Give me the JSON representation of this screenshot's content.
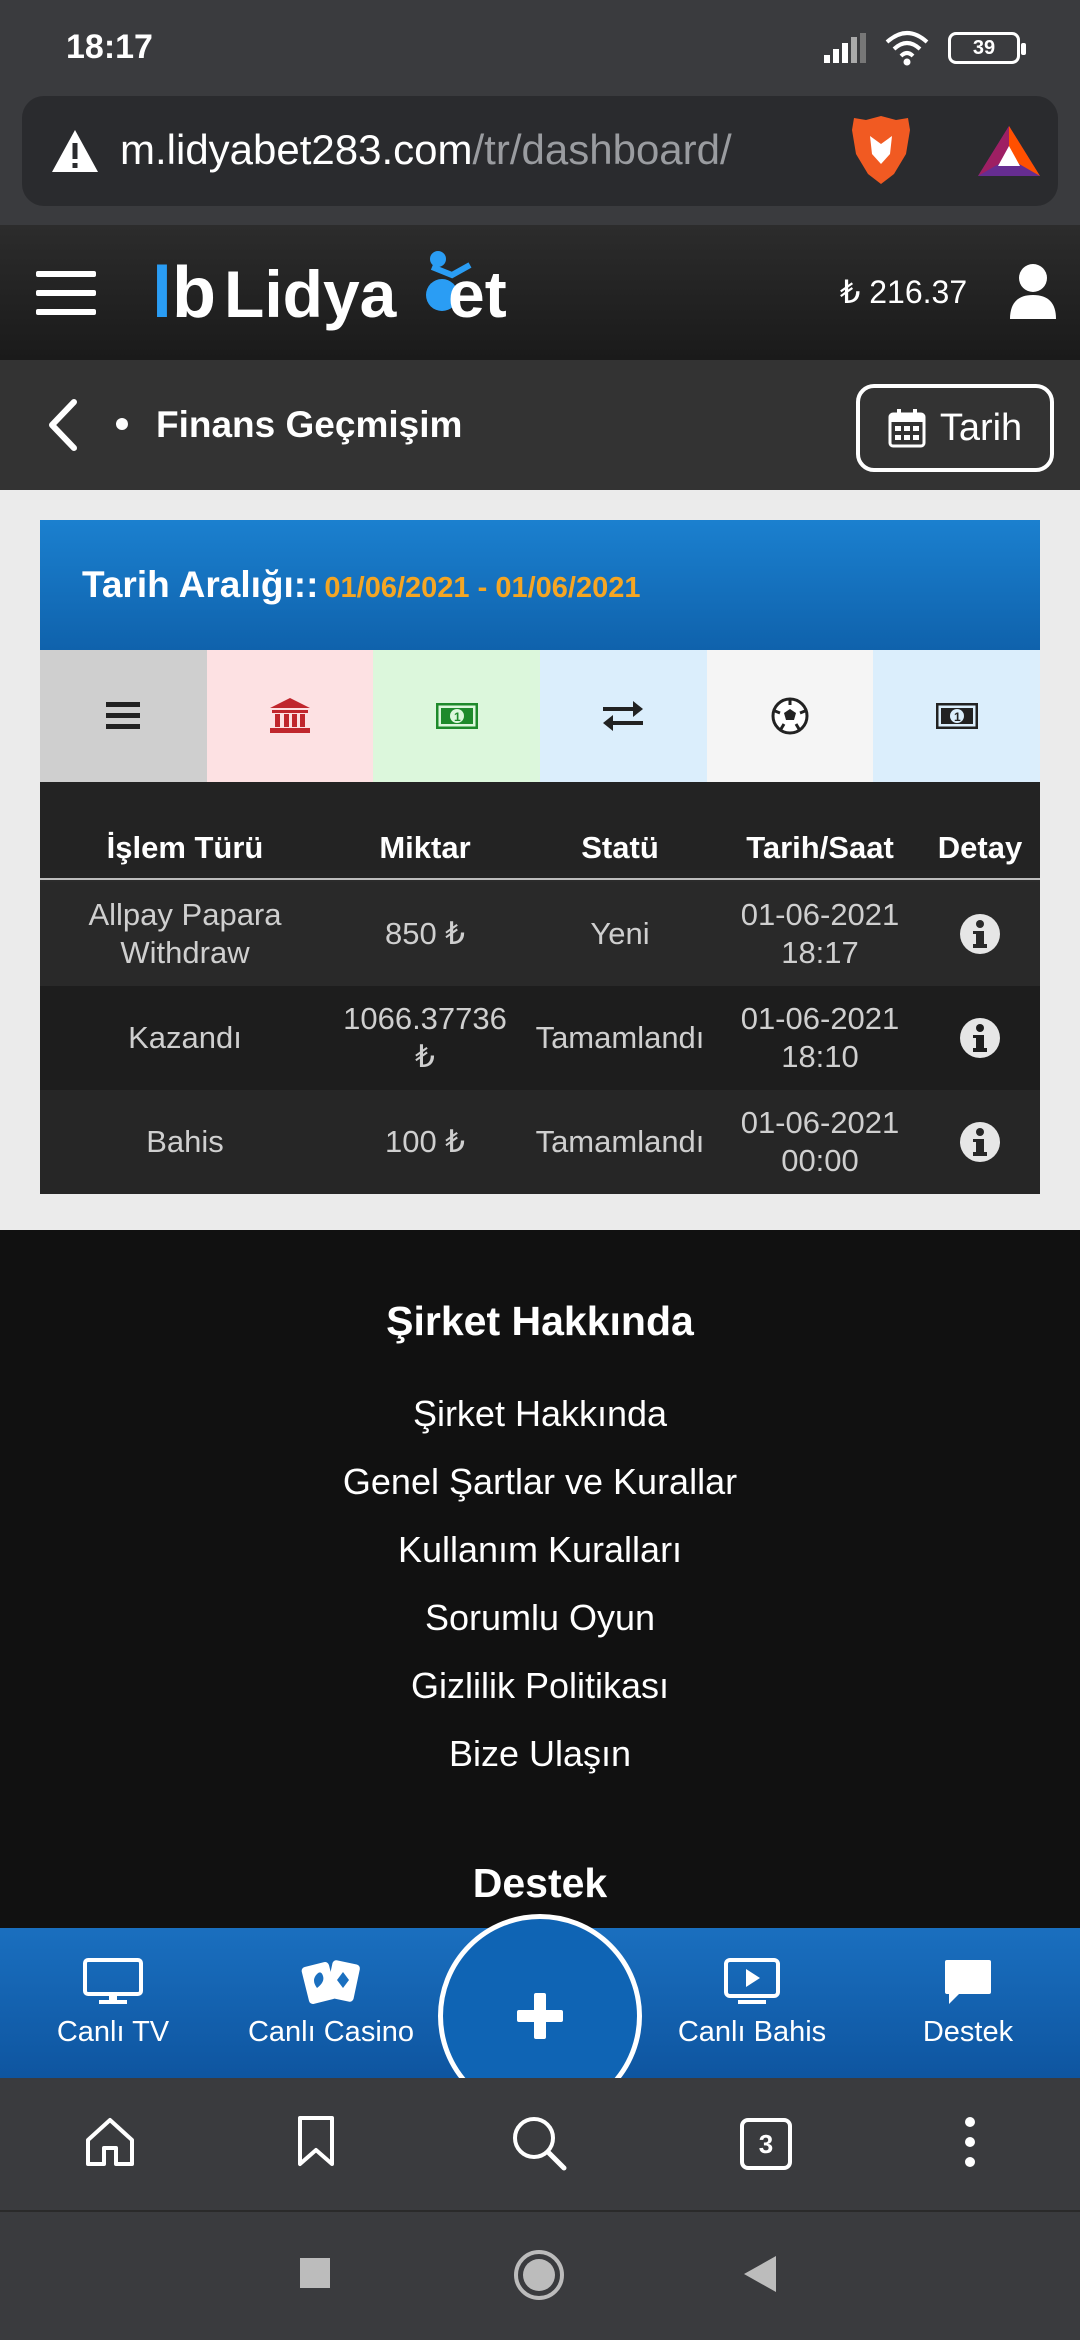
{
  "status_bar": {
    "time": "18:17",
    "battery": "39"
  },
  "browser": {
    "url_host": "m.lidyabet283.com",
    "url_path": "/tr/dashboard/",
    "tab_count": "3"
  },
  "site_header": {
    "logo_text": "LidyaBet",
    "balance": "₺ 216.37"
  },
  "title_bar": {
    "title": "Finans Geçmişim",
    "date_button": "Tarih"
  },
  "range": {
    "label": "Tarih Aralığı::",
    "value": "01/06/2021 - 01/06/2021"
  },
  "filters": [
    {
      "icon": "list-icon"
    },
    {
      "icon": "bank-icon"
    },
    {
      "icon": "money-icon"
    },
    {
      "icon": "transfer-icon"
    },
    {
      "icon": "football-icon"
    },
    {
      "icon": "banknote-icon"
    }
  ],
  "table": {
    "headers": {
      "type": "İşlem Türü",
      "amount": "Miktar",
      "status": "Statü",
      "datetime": "Tarih/Saat",
      "detail": "Detay"
    },
    "rows": [
      {
        "type": "Allpay Papara Withdraw",
        "amount": "850 ₺",
        "status": "Yeni",
        "date": "01-06-2021",
        "time": "18:17"
      },
      {
        "type": "Kazandı",
        "amount": "1066.37736 ₺",
        "status": "Tamamlandı",
        "date": "01-06-2021",
        "time": "18:10"
      },
      {
        "type": "Bahis",
        "amount": "100 ₺",
        "status": "Tamamlandı",
        "date": "01-06-2021",
        "time": "00:00"
      }
    ]
  },
  "footer": {
    "company_heading": "Şirket Hakkında",
    "links": [
      "Şirket Hakkında",
      "Genel Şartlar ve Kurallar",
      "Kullanım Kuralları",
      "Sorumlu Oyun",
      "Gizlilik Politikası",
      "Bize Ulaşın"
    ],
    "support_heading": "Destek"
  },
  "site_nav": {
    "live_tv": "Canlı TV",
    "live_casino": "Canlı Casino",
    "live_betting": "Canlı Bahis",
    "support": "Destek"
  },
  "colors": {
    "brand_blue": "#1473c4",
    "range_value_orange": "#f5a623"
  }
}
